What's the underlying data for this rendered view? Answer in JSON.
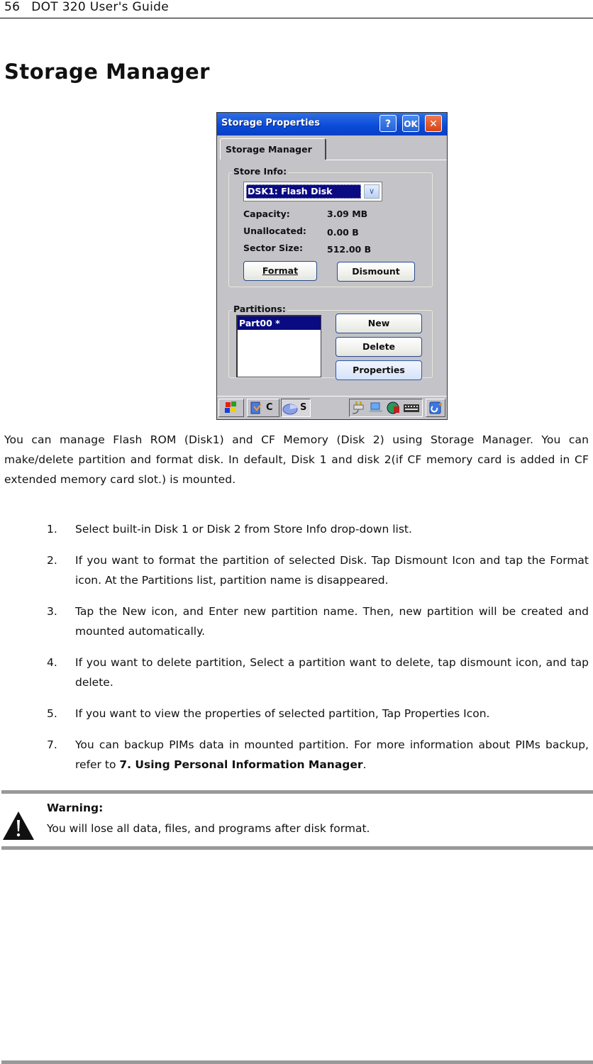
{
  "header": {
    "page_number": "56",
    "guide_title": "DOT 320 User's Guide"
  },
  "section_title": "Storage Manager",
  "screenshot": {
    "window_title": "Storage Properties",
    "title_buttons": {
      "help": "?",
      "ok": "OK",
      "close": "✕"
    },
    "tab": "Storage Manager",
    "store_info": {
      "label": "Store Info:",
      "selected_disk": "DSK1: Flash Disk",
      "fields": [
        {
          "label": "Capacity:",
          "value": "3.09 MB"
        },
        {
          "label": "Unallocated:",
          "value": "0.00 B"
        },
        {
          "label": "Sector Size:",
          "value": "512.00 B"
        }
      ],
      "buttons": {
        "format": "Format",
        "dismount": "Dismount"
      }
    },
    "partitions": {
      "label": "Partitions:",
      "items": [
        "Part00 *"
      ],
      "buttons": {
        "new": "New",
        "delete": "Delete",
        "properties": "Properties"
      }
    },
    "taskbar": {
      "app1_label": "C",
      "app2_label": "S"
    }
  },
  "intro": "You can manage Flash ROM (Disk1) and CF Memory (Disk 2) using Storage Manager. You can make/delete partition and format disk. In default, Disk 1 and disk 2(if CF memory card is added in CF extended memory card slot.) is mounted.",
  "steps": [
    {
      "num": "1.",
      "text": "Select built-in Disk 1 or Disk 2 from Store Info drop-down list."
    },
    {
      "num": "2.",
      "text": "If you want to format the partition of selected Disk. Tap Dismount Icon and tap the Format icon. At the Partitions list, partition name is disappeared."
    },
    {
      "num": "3.",
      "text": "Tap the New icon, and Enter new partition name. Then, new partition will be created and mounted automatically."
    },
    {
      "num": "4.",
      "text": "If you want to delete partition, Select a partition want to delete, tap dismount icon, and tap delete."
    },
    {
      "num": "5.",
      "text": "If you want to view the properties of selected partition, Tap Properties Icon."
    },
    {
      "num": "7.",
      "text": "You can backup PIMs data in mounted partition. For more information about PIMs backup, refer to ",
      "ref": "7. Using Personal Information Manager",
      "suffix": "."
    }
  ],
  "warning": {
    "title": "Warning:",
    "text": "You will lose all data, files, and programs after disk format."
  }
}
